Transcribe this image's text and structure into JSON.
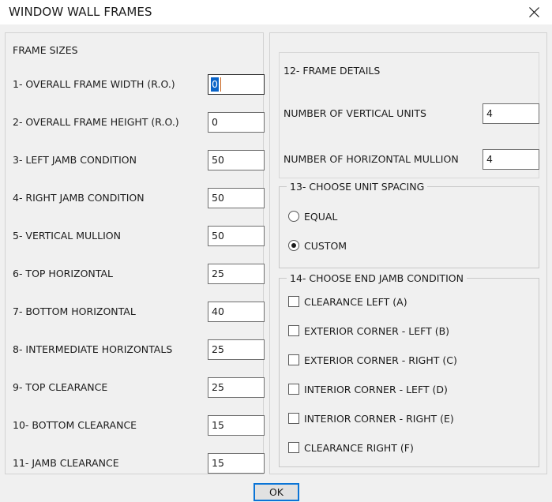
{
  "window": {
    "title": "WINDOW WALL FRAMES",
    "close_icon": "close-icon"
  },
  "left_panel": {
    "caption": "FRAME SIZES",
    "rows": [
      {
        "label": "1- OVERALL FRAME WIDTH (R.O.)",
        "value": "0",
        "focused": true
      },
      {
        "label": "2- OVERALL FRAME HEIGHT (R.O.)",
        "value": "0",
        "focused": false
      },
      {
        "label": "3- LEFT JAMB CONDITION",
        "value": "50",
        "focused": false
      },
      {
        "label": "4- RIGHT JAMB CONDITION",
        "value": "50",
        "focused": false
      },
      {
        "label": "5- VERTICAL MULLION",
        "value": "50",
        "focused": false
      },
      {
        "label": "6- TOP HORIZONTAL",
        "value": "25",
        "focused": false
      },
      {
        "label": "7- BOTTOM HORIZONTAL",
        "value": "40",
        "focused": false
      },
      {
        "label": "8- INTERMEDIATE HORIZONTALS",
        "value": "25",
        "focused": false
      },
      {
        "label": "9- TOP CLEARANCE",
        "value": "25",
        "focused": false
      },
      {
        "label": "10- BOTTOM CLEARANCE",
        "value": "15",
        "focused": false
      },
      {
        "label": "11- JAMB CLEARANCE",
        "value": "15",
        "focused": false
      }
    ]
  },
  "frame_details": {
    "caption": "12- FRAME DETAILS",
    "rows": [
      {
        "label": "NUMBER OF VERTICAL UNITS",
        "value": "4"
      },
      {
        "label": "NUMBER OF HORIZONTAL MULLION",
        "value": "4"
      }
    ]
  },
  "unit_spacing": {
    "legend": "13- CHOOSE UNIT SPACING",
    "options": [
      {
        "label": "EQUAL",
        "selected": false
      },
      {
        "label": "CUSTOM",
        "selected": true
      }
    ]
  },
  "end_jamb": {
    "legend": "14- CHOOSE END JAMB CONDITION",
    "options": [
      {
        "label": "CLEARANCE LEFT (A)",
        "checked": false
      },
      {
        "label": "EXTERIOR CORNER - LEFT (B)",
        "checked": false
      },
      {
        "label": "EXTERIOR CORNER - RIGHT (C)",
        "checked": false
      },
      {
        "label": "INTERIOR CORNER - LEFT (D)",
        "checked": false
      },
      {
        "label": "INTERIOR CORNER - RIGHT (E)",
        "checked": false
      },
      {
        "label": "CLEARANCE RIGHT (F)",
        "checked": false
      }
    ]
  },
  "footer": {
    "ok_label": "OK"
  },
  "colors": {
    "selection_blue": "#0a64c8",
    "focus_blue": "#0a74d6",
    "dialog_background": "#f0f0f0",
    "field_background": "#ffffff",
    "text": "#1b1b1b"
  }
}
